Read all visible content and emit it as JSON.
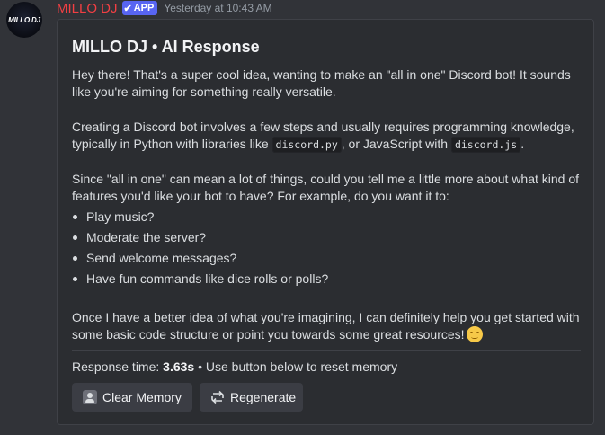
{
  "author": {
    "avatar_text": "MILLO DJ",
    "username": "MILLO DJ",
    "badge": "APP",
    "timestamp": "Yesterday at 10:43 AM"
  },
  "embed": {
    "title": "MILLO DJ • AI Response",
    "p1": "Hey there! That's a super cool idea, wanting to make an \"all in one\" Discord bot! It sounds like you're aiming for something really versatile.",
    "p2_a": "Creating a Discord bot involves a few steps and usually requires programming knowledge, typically in Python with libraries like ",
    "p2_code1": "discord.py",
    "p2_b": ", or JavaScript with ",
    "p2_code2": "discord.js",
    "p2_c": ".",
    "p3": "Since \"all in one\" can mean a lot of things, could you tell me a little more about what kind of features you'd like your bot to have? For example, do you want it to:",
    "bullets": [
      "Play music?",
      "Moderate the server?",
      "Send welcome messages?",
      "Have fun commands like dice rolls or polls?"
    ],
    "p4": "Once I have a better idea of what you're imagining, I can definitely help you get started with some basic code structure or point you towards some great resources!",
    "emoji_icon": "smiling-face-icon",
    "footer_label": "Response time: ",
    "footer_time": "3.63s",
    "footer_rest": " • Use button below to reset memory"
  },
  "buttons": {
    "clear_label": "Clear Memory",
    "regen_label": "Regenerate"
  },
  "colors": {
    "username": "#f23f43",
    "badge": "#5865f2",
    "background": "#313338",
    "embed_bg": "#2b2d31"
  }
}
